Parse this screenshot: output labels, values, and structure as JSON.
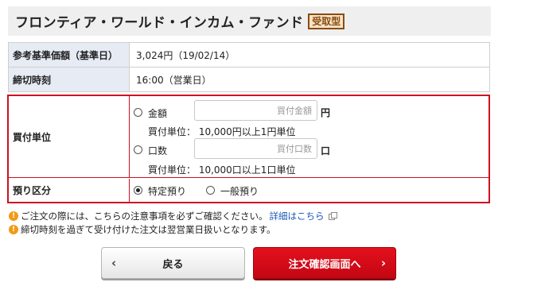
{
  "fund": {
    "name": "フロンティア・ワールド・インカム・ファンド",
    "badge": "受取型"
  },
  "info": {
    "price_label": "参考基準価額（基準日）",
    "price_value": "3,024円（19/02/14）",
    "cutoff_label": "締切時刻",
    "cutoff_value": "16:00（営業日）"
  },
  "order": {
    "unit_label": "買付単位",
    "amount_option": "金額",
    "amount_placeholder": "買付金額",
    "amount_unit": "円",
    "amount_note": "買付単位： 10,000円以上1円単位",
    "units_option": "口数",
    "units_placeholder": "買付口数",
    "units_unit": "口",
    "units_note": "買付単位： 10,000口以上1口単位",
    "deposit_label": "預り区分",
    "deposit_options": [
      "特定預り",
      "一般預り"
    ],
    "deposit_selected": "特定預り"
  },
  "notes": {
    "note1_text": "ご注文の際には、こちらの注意事項を必ずご確認ください。",
    "note1_link": "詳細はこちら",
    "note2_text": "締切時刻を過ぎて受け付けた注文は翌営業日扱いとなります。"
  },
  "buttons": {
    "back": "戻る",
    "next": "注文確認画面へ"
  },
  "colors": {
    "accent_red": "#cc1122",
    "label_bg": "#e6ebf4",
    "badge_brown": "#8a4b12",
    "link_blue": "#1a56b8",
    "warning_orange": "#f29a15"
  }
}
